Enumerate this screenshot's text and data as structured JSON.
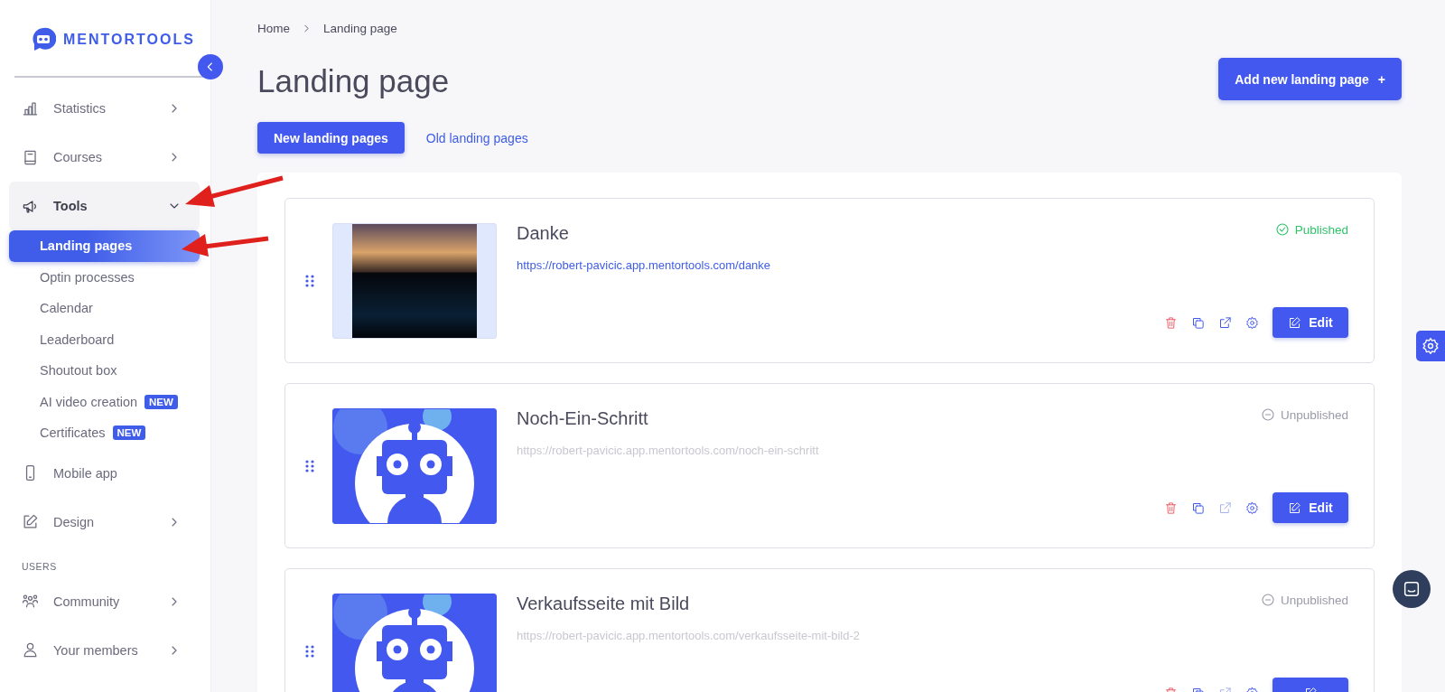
{
  "logo": {
    "text": "MENTORTOOLS"
  },
  "sidebar": {
    "items": [
      {
        "kind": "nav",
        "label": "Statistics",
        "expanded": false
      },
      {
        "kind": "nav",
        "label": "Courses",
        "expanded": false
      },
      {
        "kind": "nav",
        "label": "Tools",
        "expanded": true,
        "children": [
          {
            "label": "Landing pages",
            "selected": true
          },
          {
            "label": "Optin processes",
            "selected": false
          },
          {
            "label": "Calendar",
            "selected": false
          },
          {
            "label": "Leaderboard",
            "selected": false
          },
          {
            "label": "Shoutout box",
            "selected": false
          },
          {
            "label": "AI video creation",
            "selected": false,
            "badge": "NEW"
          },
          {
            "label": "Certificates",
            "selected": false,
            "badge": "NEW"
          }
        ]
      },
      {
        "kind": "link",
        "label": "Mobile app"
      },
      {
        "kind": "nav",
        "label": "Design",
        "expanded": false
      },
      {
        "kind": "heading",
        "label": "USERS"
      },
      {
        "kind": "nav",
        "label": "Community",
        "expanded": false
      },
      {
        "kind": "nav",
        "label": "Your members",
        "expanded": false
      }
    ]
  },
  "breadcrumb": [
    {
      "label": "Home"
    },
    {
      "label": "Landing page"
    }
  ],
  "page_title": "Landing page",
  "add_button": {
    "label": "Add new landing page",
    "icon": "+"
  },
  "tabs": [
    {
      "label": "New landing pages",
      "selected": true
    },
    {
      "label": "Old landing pages",
      "selected": false
    }
  ],
  "landing_pages": [
    {
      "title": "Danke",
      "url": "https://robert-pavicic.app.mentortools.com/danke",
      "status": "Published",
      "published": true,
      "kind": "photo",
      "edit_label": "Edit"
    },
    {
      "title": "Noch-Ein-Schritt",
      "url": "https://robert-pavicic.app.mentortools.com/noch-ein-schritt",
      "status": "Unpublished",
      "published": false,
      "kind": "robot",
      "edit_label": "Edit"
    },
    {
      "title": "Verkaufsseite mit Bild",
      "url": "https://robert-pavicic.app.mentortools.com/verkaufsseite-mit-bild-2",
      "status": "Unpublished",
      "published": false,
      "kind": "robot"
    }
  ]
}
